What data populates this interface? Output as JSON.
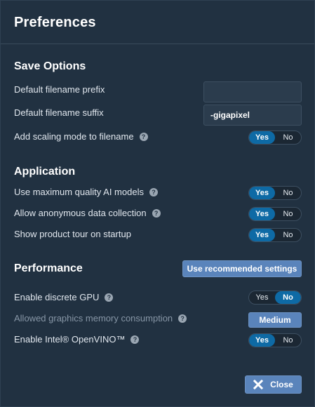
{
  "dialog": {
    "title": "Preferences"
  },
  "save_options": {
    "heading": "Save Options",
    "prefix_label": "Default filename prefix",
    "prefix_value": "",
    "suffix_label": "Default filename suffix",
    "suffix_value": "-gigapixel",
    "scaling_mode_label": "Add scaling mode to filename",
    "scaling_mode_value": "Yes"
  },
  "application": {
    "heading": "Application",
    "max_quality_label": "Use maximum quality AI models",
    "max_quality_value": "Yes",
    "anon_data_label": "Allow anonymous data collection",
    "anon_data_value": "Yes",
    "product_tour_label": "Show product tour on startup",
    "product_tour_value": "Yes"
  },
  "performance": {
    "heading": "Performance",
    "recommended_button": "Use recommended settings",
    "discrete_gpu_label": "Enable discrete GPU",
    "discrete_gpu_value": "No",
    "memory_label": "Allowed graphics memory consumption",
    "memory_value": "Medium",
    "openvino_label": "Enable Intel® OpenVINO™",
    "openvino_value": "Yes"
  },
  "toggle_options": {
    "yes": "Yes",
    "no": "No"
  },
  "help_glyph": "?",
  "footer": {
    "close_label": "Close"
  },
  "colors": {
    "accent": "#0e6aa5",
    "button": "#5a84bb",
    "background": "#213141"
  }
}
